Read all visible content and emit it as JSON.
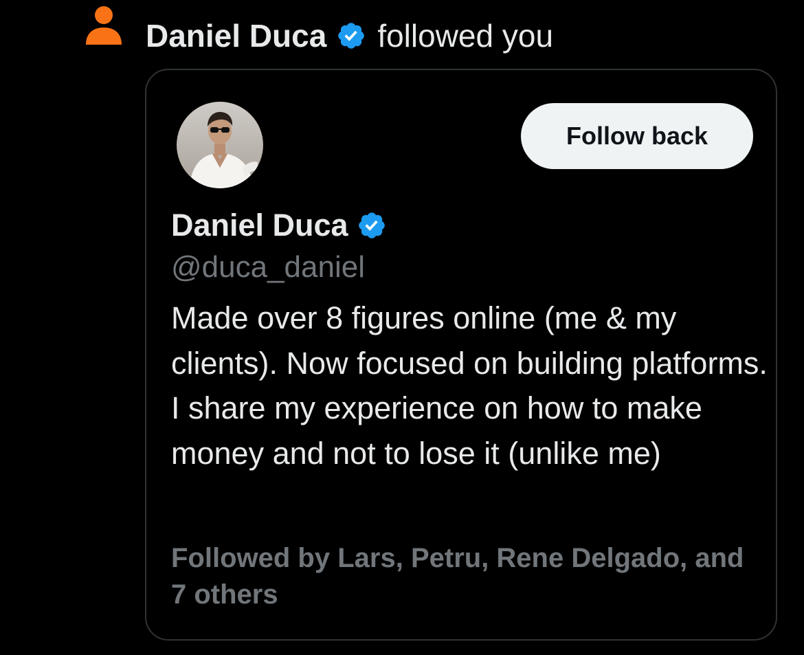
{
  "notification": {
    "icon": "person-icon",
    "icon_color": "#f97316",
    "user_name": "Daniel Duca",
    "action_text": "followed you"
  },
  "card": {
    "avatar": "profile-photo",
    "follow_button_label": "Follow back",
    "display_name": "Daniel Duca",
    "handle": "@duca_daniel",
    "bio": "Made over 8 figures online (me & my clients). Now focused on building platforms. I share my experience on how to make money and not to lose it (unlike me)",
    "followed_by": "Followed by Lars, Petru, Rene Delgado, and 7 others"
  },
  "colors": {
    "background": "#000000",
    "text_primary": "#e7e9ea",
    "text_secondary": "#71767b",
    "verified_badge": "#1d9bf0",
    "button_bg": "#eff3f4",
    "card_border": "#2f3336"
  }
}
